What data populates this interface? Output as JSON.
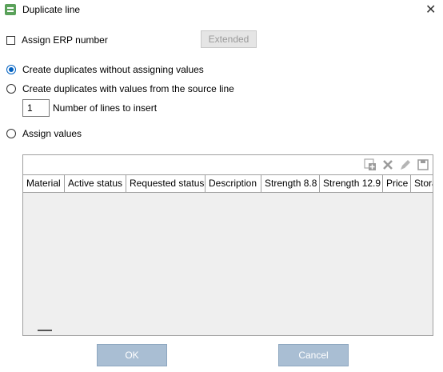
{
  "window": {
    "title": "Duplicate line",
    "close_label": "✕"
  },
  "assign_erp": {
    "label": "Assign ERP number",
    "checked": false
  },
  "extended_button": {
    "label": "Extended"
  },
  "options": [
    {
      "label": "Create duplicates without assigning values",
      "selected": true
    },
    {
      "label": "Create duplicates with values from the source line",
      "selected": false
    },
    {
      "label": "Assign values",
      "selected": false
    }
  ],
  "lines_to_insert": {
    "value": "1",
    "label": "Number of lines to insert"
  },
  "grid": {
    "toolbar_icons": [
      "add-row-icon",
      "delete-icon",
      "edit-icon",
      "save-icon"
    ],
    "columns": [
      "Material",
      "Active status",
      "Requested status",
      "Description",
      "Strength 8.8",
      "Strength 12.9",
      "Price",
      "Stora"
    ]
  },
  "buttons": {
    "ok": "OK",
    "cancel": "Cancel"
  },
  "colors": {
    "accent": "#0060c0",
    "disabled_button": "#a9bed3"
  }
}
